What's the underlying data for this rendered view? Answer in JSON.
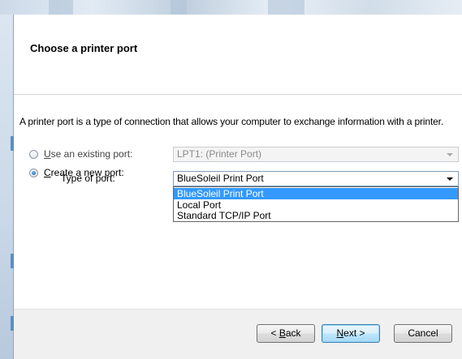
{
  "header": {
    "title": "Choose a printer port"
  },
  "description": "A printer port is a type of connection that allows your computer to exchange information with a printer.",
  "existing_port": {
    "label_accel": "U",
    "label_rest": "se an existing port:",
    "value": "LPT1: (Printer Port)",
    "checked": false
  },
  "new_port": {
    "label_accel": "C",
    "label_rest": "reate a new port:",
    "checked": true
  },
  "type_of_port": {
    "label": "Type of port:",
    "value": "BlueSoleil Print Port",
    "options": [
      "BlueSoleil Print Port",
      "Local Port",
      "Standard TCP/IP Port"
    ],
    "highlighted": "BlueSoleil Print Port"
  },
  "buttons": {
    "back_prefix": "< ",
    "back_accel": "B",
    "back_rest": "ack",
    "next_accel": "N",
    "next_rest": "ext >",
    "cancel": "Cancel"
  },
  "colors": {
    "selection": "#3399ff",
    "footer": "#f0f0f0",
    "default_button_border": "#3c7fb1"
  },
  "icons": {
    "dropdown_arrow": "chevron-down-icon"
  }
}
